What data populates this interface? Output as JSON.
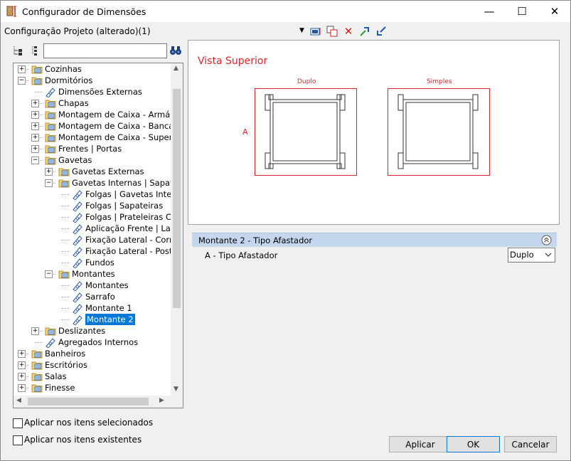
{
  "window": {
    "title": "Configurador de Dimensões",
    "minimize": "—",
    "maximize": "☐",
    "close": "✕"
  },
  "config_label": "Configuração Projeto (alterado)(1)",
  "search": {
    "value": "",
    "placeholder": ""
  },
  "tree": [
    {
      "label": "Cozinhas",
      "depth": 0,
      "kind": "folder",
      "expander": "+"
    },
    {
      "label": "Dormitórios",
      "depth": 0,
      "kind": "folder",
      "expander": "−"
    },
    {
      "label": "Dimensões Externas",
      "depth": 1,
      "kind": "leaf"
    },
    {
      "label": "Chapas",
      "depth": 1,
      "kind": "folder",
      "expander": "+"
    },
    {
      "label": "Montagem de Caixa - Armário",
      "depth": 1,
      "kind": "folder",
      "expander": "+"
    },
    {
      "label": "Montagem de Caixa - Bancada",
      "depth": 1,
      "kind": "folder",
      "expander": "+"
    },
    {
      "label": "Montagem de Caixa - Superior",
      "depth": 1,
      "kind": "folder",
      "expander": "+"
    },
    {
      "label": "Frentes | Portas",
      "depth": 1,
      "kind": "folder",
      "expander": "+"
    },
    {
      "label": "Gavetas",
      "depth": 1,
      "kind": "folder",
      "expander": "−"
    },
    {
      "label": "Gavetas Externas",
      "depth": 2,
      "kind": "folder",
      "expander": "+"
    },
    {
      "label": "Gavetas Internas | Sapateiras",
      "depth": 2,
      "kind": "folder",
      "expander": "−"
    },
    {
      "label": "Folgas | Gavetas Internas",
      "depth": 3,
      "kind": "leaf"
    },
    {
      "label": "Folgas | Sapateiras",
      "depth": 3,
      "kind": "leaf"
    },
    {
      "label": "Folgas | Prateleiras Corrediças",
      "depth": 3,
      "kind": "leaf"
    },
    {
      "label": "Aplicação Frente | Lateral",
      "depth": 3,
      "kind": "leaf"
    },
    {
      "label": "Fixação Lateral - Corrediça",
      "depth": 3,
      "kind": "leaf"
    },
    {
      "label": "Fixação Lateral - Posterior",
      "depth": 3,
      "kind": "leaf"
    },
    {
      "label": "Fundos",
      "depth": 3,
      "kind": "leaf"
    },
    {
      "label": "Montantes",
      "depth": 2,
      "kind": "folder",
      "expander": "−"
    },
    {
      "label": "Montantes",
      "depth": 3,
      "kind": "leaf"
    },
    {
      "label": "Sarrafo",
      "depth": 3,
      "kind": "leaf"
    },
    {
      "label": "Montante 1",
      "depth": 3,
      "kind": "leaf"
    },
    {
      "label": "Montante 2",
      "depth": 3,
      "kind": "leaf",
      "selected": true
    },
    {
      "label": "Deslizantes",
      "depth": 1,
      "kind": "folder",
      "expander": "+"
    },
    {
      "label": "Agregados Internos",
      "depth": 1,
      "kind": "leaf"
    },
    {
      "label": "Banheiros",
      "depth": 0,
      "kind": "folder",
      "expander": "+"
    },
    {
      "label": "Escritórios",
      "depth": 0,
      "kind": "folder",
      "expander": "+"
    },
    {
      "label": "Salas",
      "depth": 0,
      "kind": "folder",
      "expander": "+"
    },
    {
      "label": "Finesse",
      "depth": 0,
      "kind": "folder",
      "expander": "+"
    }
  ],
  "preview": {
    "title": "Vista Superior",
    "label_left": "Duplo",
    "label_right": "Simples",
    "dim_a": "A"
  },
  "props": {
    "section_title": "Montante 2 - Tipo Afastador",
    "row_label": "A - Tipo Afastador",
    "row_value": "Duplo"
  },
  "checkboxes": [
    {
      "label": "Aplicar nos itens selecionados",
      "checked": false
    },
    {
      "label": "Aplicar nos itens existentes",
      "checked": false
    }
  ],
  "buttons": {
    "apply": "Aplicar",
    "ok": "OK",
    "cancel": "Cancelar"
  },
  "colors": {
    "accent_red": "#e0252b",
    "selection": "#0078d7",
    "section_header": "#c5d7ef"
  }
}
